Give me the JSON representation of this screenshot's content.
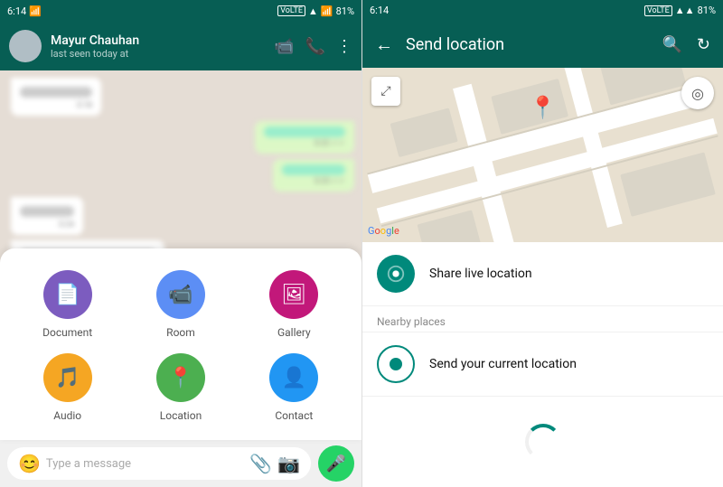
{
  "left": {
    "statusBar": {
      "time": "6:14",
      "batteryLevel": "81%",
      "signals": "VoLTE"
    },
    "header": {
      "name": "Mayur Chauhan",
      "status": "last seen today at",
      "callIcon": "📞"
    },
    "chatInput": {
      "placeholder": "Type a message"
    },
    "attachMenu": {
      "items": [
        {
          "id": "document",
          "label": "Document",
          "icon": "📄",
          "colorClass": "icon-doc"
        },
        {
          "id": "room",
          "label": "Room",
          "icon": "🎥",
          "colorClass": "icon-room"
        },
        {
          "id": "gallery",
          "label": "Gallery",
          "icon": "🖼",
          "colorClass": "icon-gallery"
        },
        {
          "id": "audio",
          "label": "Audio",
          "icon": "🎵",
          "colorClass": "icon-audio"
        },
        {
          "id": "location",
          "label": "Location",
          "icon": "📍",
          "colorClass": "icon-location"
        },
        {
          "id": "contact",
          "label": "Contact",
          "icon": "👤",
          "colorClass": "icon-contact"
        }
      ]
    }
  },
  "right": {
    "statusBar": {
      "time": "6:14",
      "batteryLevel": "81%"
    },
    "header": {
      "title": "Send location",
      "backIcon": "←",
      "searchIcon": "🔍",
      "refreshIcon": "↻"
    },
    "map": {
      "googleText": "Google"
    },
    "options": {
      "shareLiveLabel": "Share live location",
      "nearbyLabel": "Nearby places",
      "currentLocationLabel": "Send your current location"
    }
  }
}
